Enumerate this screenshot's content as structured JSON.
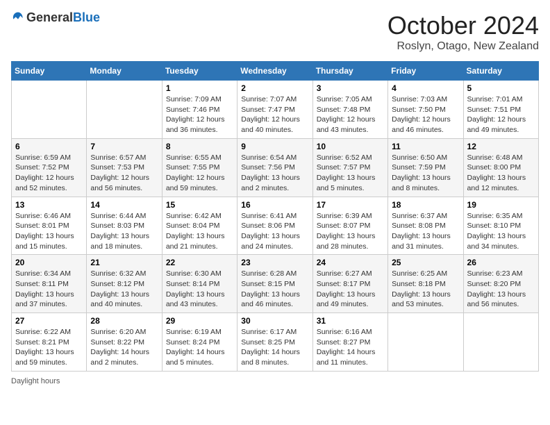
{
  "logo": {
    "text_general": "General",
    "text_blue": "Blue"
  },
  "header": {
    "month": "October 2024",
    "location": "Roslyn, Otago, New Zealand"
  },
  "weekdays": [
    "Sunday",
    "Monday",
    "Tuesday",
    "Wednesday",
    "Thursday",
    "Friday",
    "Saturday"
  ],
  "footer": {
    "daylight_label": "Daylight hours"
  },
  "weeks": [
    [
      null,
      null,
      {
        "day": "1",
        "sunrise": "Sunrise: 7:09 AM",
        "sunset": "Sunset: 7:46 PM",
        "daylight": "Daylight: 12 hours and 36 minutes."
      },
      {
        "day": "2",
        "sunrise": "Sunrise: 7:07 AM",
        "sunset": "Sunset: 7:47 PM",
        "daylight": "Daylight: 12 hours and 40 minutes."
      },
      {
        "day": "3",
        "sunrise": "Sunrise: 7:05 AM",
        "sunset": "Sunset: 7:48 PM",
        "daylight": "Daylight: 12 hours and 43 minutes."
      },
      {
        "day": "4",
        "sunrise": "Sunrise: 7:03 AM",
        "sunset": "Sunset: 7:50 PM",
        "daylight": "Daylight: 12 hours and 46 minutes."
      },
      {
        "day": "5",
        "sunrise": "Sunrise: 7:01 AM",
        "sunset": "Sunset: 7:51 PM",
        "daylight": "Daylight: 12 hours and 49 minutes."
      }
    ],
    [
      {
        "day": "6",
        "sunrise": "Sunrise: 6:59 AM",
        "sunset": "Sunset: 7:52 PM",
        "daylight": "Daylight: 12 hours and 52 minutes."
      },
      {
        "day": "7",
        "sunrise": "Sunrise: 6:57 AM",
        "sunset": "Sunset: 7:53 PM",
        "daylight": "Daylight: 12 hours and 56 minutes."
      },
      {
        "day": "8",
        "sunrise": "Sunrise: 6:55 AM",
        "sunset": "Sunset: 7:55 PM",
        "daylight": "Daylight: 12 hours and 59 minutes."
      },
      {
        "day": "9",
        "sunrise": "Sunrise: 6:54 AM",
        "sunset": "Sunset: 7:56 PM",
        "daylight": "Daylight: 13 hours and 2 minutes."
      },
      {
        "day": "10",
        "sunrise": "Sunrise: 6:52 AM",
        "sunset": "Sunset: 7:57 PM",
        "daylight": "Daylight: 13 hours and 5 minutes."
      },
      {
        "day": "11",
        "sunrise": "Sunrise: 6:50 AM",
        "sunset": "Sunset: 7:59 PM",
        "daylight": "Daylight: 13 hours and 8 minutes."
      },
      {
        "day": "12",
        "sunrise": "Sunrise: 6:48 AM",
        "sunset": "Sunset: 8:00 PM",
        "daylight": "Daylight: 13 hours and 12 minutes."
      }
    ],
    [
      {
        "day": "13",
        "sunrise": "Sunrise: 6:46 AM",
        "sunset": "Sunset: 8:01 PM",
        "daylight": "Daylight: 13 hours and 15 minutes."
      },
      {
        "day": "14",
        "sunrise": "Sunrise: 6:44 AM",
        "sunset": "Sunset: 8:03 PM",
        "daylight": "Daylight: 13 hours and 18 minutes."
      },
      {
        "day": "15",
        "sunrise": "Sunrise: 6:42 AM",
        "sunset": "Sunset: 8:04 PM",
        "daylight": "Daylight: 13 hours and 21 minutes."
      },
      {
        "day": "16",
        "sunrise": "Sunrise: 6:41 AM",
        "sunset": "Sunset: 8:06 PM",
        "daylight": "Daylight: 13 hours and 24 minutes."
      },
      {
        "day": "17",
        "sunrise": "Sunrise: 6:39 AM",
        "sunset": "Sunset: 8:07 PM",
        "daylight": "Daylight: 13 hours and 28 minutes."
      },
      {
        "day": "18",
        "sunrise": "Sunrise: 6:37 AM",
        "sunset": "Sunset: 8:08 PM",
        "daylight": "Daylight: 13 hours and 31 minutes."
      },
      {
        "day": "19",
        "sunrise": "Sunrise: 6:35 AM",
        "sunset": "Sunset: 8:10 PM",
        "daylight": "Daylight: 13 hours and 34 minutes."
      }
    ],
    [
      {
        "day": "20",
        "sunrise": "Sunrise: 6:34 AM",
        "sunset": "Sunset: 8:11 PM",
        "daylight": "Daylight: 13 hours and 37 minutes."
      },
      {
        "day": "21",
        "sunrise": "Sunrise: 6:32 AM",
        "sunset": "Sunset: 8:12 PM",
        "daylight": "Daylight: 13 hours and 40 minutes."
      },
      {
        "day": "22",
        "sunrise": "Sunrise: 6:30 AM",
        "sunset": "Sunset: 8:14 PM",
        "daylight": "Daylight: 13 hours and 43 minutes."
      },
      {
        "day": "23",
        "sunrise": "Sunrise: 6:28 AM",
        "sunset": "Sunset: 8:15 PM",
        "daylight": "Daylight: 13 hours and 46 minutes."
      },
      {
        "day": "24",
        "sunrise": "Sunrise: 6:27 AM",
        "sunset": "Sunset: 8:17 PM",
        "daylight": "Daylight: 13 hours and 49 minutes."
      },
      {
        "day": "25",
        "sunrise": "Sunrise: 6:25 AM",
        "sunset": "Sunset: 8:18 PM",
        "daylight": "Daylight: 13 hours and 53 minutes."
      },
      {
        "day": "26",
        "sunrise": "Sunrise: 6:23 AM",
        "sunset": "Sunset: 8:20 PM",
        "daylight": "Daylight: 13 hours and 56 minutes."
      }
    ],
    [
      {
        "day": "27",
        "sunrise": "Sunrise: 6:22 AM",
        "sunset": "Sunset: 8:21 PM",
        "daylight": "Daylight: 13 hours and 59 minutes."
      },
      {
        "day": "28",
        "sunrise": "Sunrise: 6:20 AM",
        "sunset": "Sunset: 8:22 PM",
        "daylight": "Daylight: 14 hours and 2 minutes."
      },
      {
        "day": "29",
        "sunrise": "Sunrise: 6:19 AM",
        "sunset": "Sunset: 8:24 PM",
        "daylight": "Daylight: 14 hours and 5 minutes."
      },
      {
        "day": "30",
        "sunrise": "Sunrise: 6:17 AM",
        "sunset": "Sunset: 8:25 PM",
        "daylight": "Daylight: 14 hours and 8 minutes."
      },
      {
        "day": "31",
        "sunrise": "Sunrise: 6:16 AM",
        "sunset": "Sunset: 8:27 PM",
        "daylight": "Daylight: 14 hours and 11 minutes."
      },
      null,
      null
    ]
  ]
}
